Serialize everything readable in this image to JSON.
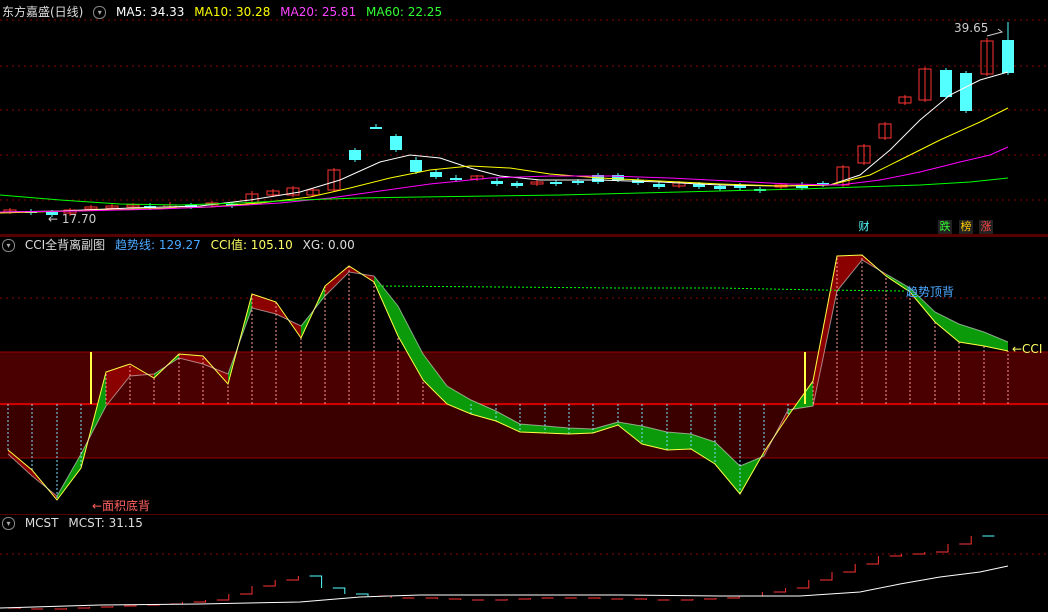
{
  "main": {
    "title": "东方嘉盛(日线)",
    "ma5": "MA5: 34.33",
    "ma10": "MA10: 30.28",
    "ma20": "MA20: 25.81",
    "ma60": "MA60: 22.25",
    "high_label": "39.65",
    "low_label": "17.70",
    "tags": [
      "财",
      "跌",
      "榜",
      "涨"
    ]
  },
  "cci": {
    "title": "CCI全背离副图",
    "trend": "趋势线: 129.27",
    "cci": "CCI值: 105.10",
    "xg": "XG: 0.00",
    "top_div": "趋势顶背",
    "bottom_div": "←面积底背",
    "cci_marker": "←CCI"
  },
  "mcst": {
    "title": "MCST",
    "value": "MCST: 31.15"
  },
  "colors": {
    "up": "#ff3232",
    "down": "#54ffff",
    "ma5": "#ffffff",
    "ma10": "#ffff00",
    "ma20": "#ff00ff",
    "ma60": "#00ff00"
  }
}
